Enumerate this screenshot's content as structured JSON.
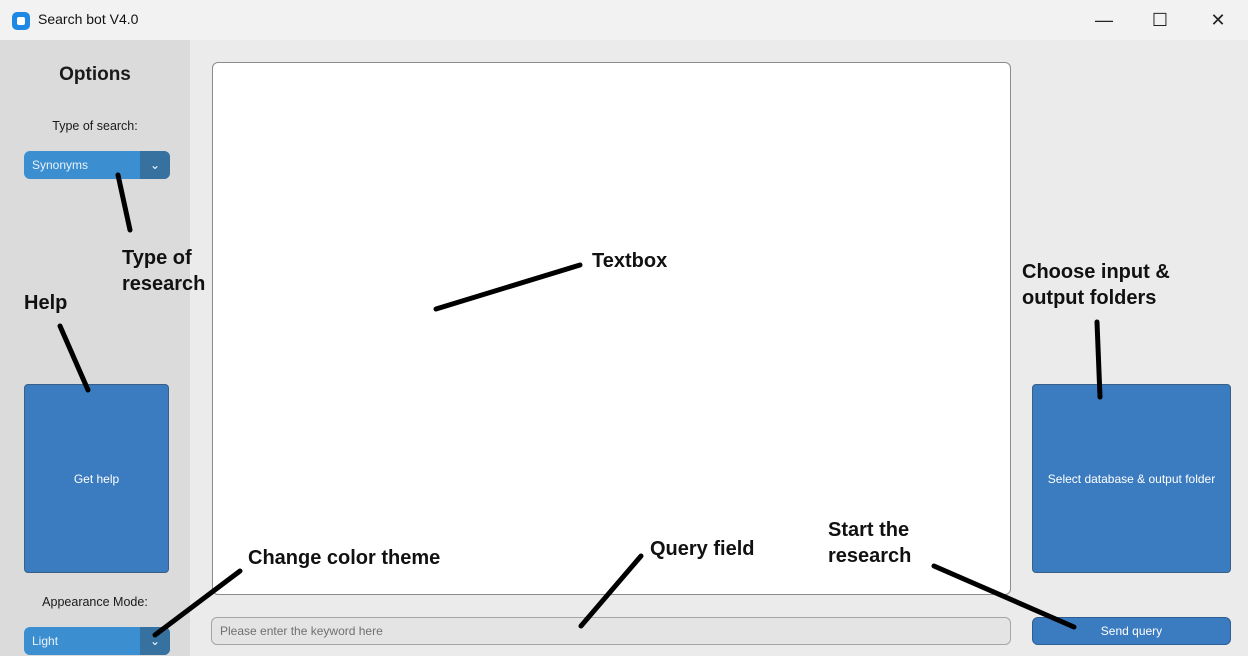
{
  "window": {
    "title": "Search bot V4.0",
    "minimize": "—",
    "maximize": "☐",
    "close": "✕"
  },
  "sidebar": {
    "title": "Options",
    "search_type_label": "Type of search:",
    "search_type_value": "Synonyms",
    "help_button": "Get help",
    "appearance_label": "Appearance Mode:",
    "appearance_value": "Light"
  },
  "main": {
    "textbox_content": "",
    "query_placeholder": "Please enter the keyword here",
    "query_value": ""
  },
  "right": {
    "select_button": "Select database & output folder",
    "send_button": "Send query"
  },
  "annotations": {
    "type_of_research_1": "Type of",
    "type_of_research_2": "research",
    "help": "Help",
    "textbox": "Textbox",
    "choose_folders_1": "Choose input &",
    "choose_folders_2": "output folders",
    "change_theme": "Change color theme",
    "query_field": "Query field",
    "start_research_1": "Start the",
    "start_research_2": "research"
  },
  "colors": {
    "button_blue": "#3b7bc0",
    "dropdown_blue": "#3b8ed0",
    "dropdown_arrow": "#36719f",
    "sidebar_bg": "#dbdbdb",
    "app_bg": "#ebebeb"
  },
  "icons": {
    "app": "app-icon",
    "dropdown_arrow": "chevron-down-icon"
  }
}
